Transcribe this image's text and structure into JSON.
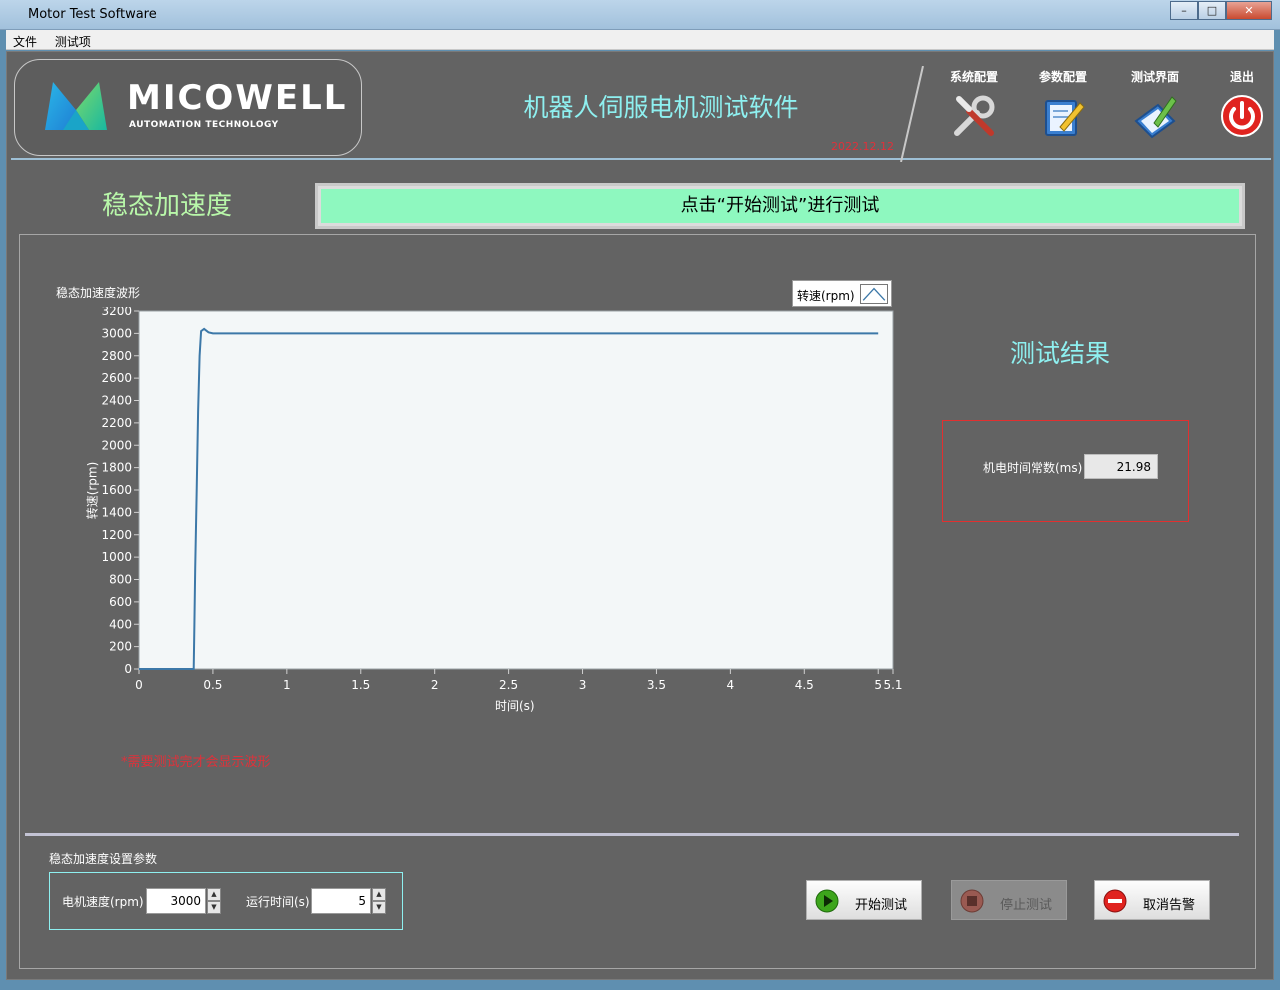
{
  "window": {
    "title": "Motor Test Software",
    "controls": {
      "minimize": "–",
      "maximize": "□",
      "close": "✕"
    }
  },
  "menu": {
    "items": [
      "文件",
      "测试项"
    ]
  },
  "header": {
    "logo_text": "MICOWELL",
    "logo_sub": "AUTOMATION TECHNOLOGY",
    "app_title": "机器人伺服电机测试软件",
    "date": "2022.12.12",
    "nav": [
      {
        "label": "系统配置",
        "icon": "tools-icon"
      },
      {
        "label": "参数配置",
        "icon": "edit-document-icon"
      },
      {
        "label": "测试界面",
        "icon": "clipboard-pen-icon"
      },
      {
        "label": "退出",
        "icon": "power-icon"
      }
    ]
  },
  "test": {
    "section_label": "稳态加速度",
    "prompt": "点击“开始测试”进行测试",
    "note": "*需要测试完才会显示波形"
  },
  "results": {
    "title": "测试结果",
    "label": "机电时间常数(ms)",
    "value": "21.98"
  },
  "params": {
    "title": "稳态加速度设置参数",
    "speed_label": "电机速度(rpm)",
    "speed_value": "3000",
    "time_label": "运行时间(s)",
    "time_value": "5"
  },
  "buttons": {
    "start": "开始测试",
    "stop": "停止测试",
    "cancel_alarm": "取消告警"
  },
  "colors": {
    "accent_cyan": "#8ef0f0",
    "accent_green": "#b8f7a9",
    "prompt_bg": "#8ef8bf",
    "alert_red": "#e0313a",
    "series": "#3c78a8"
  },
  "chart_data": {
    "type": "line",
    "title": "稳态加速度波形",
    "xlabel": "时间(s)",
    "ylabel": "转速(rpm)",
    "xlim": [
      0,
      5.1
    ],
    "ylim": [
      0,
      3200
    ],
    "x_ticks": [
      0,
      0.5,
      1,
      1.5,
      2,
      2.5,
      3,
      3.5,
      4,
      4.5,
      5,
      5.1
    ],
    "x_tick_labels": [
      "0",
      "0.5",
      "1",
      "1.5",
      "2",
      "2.5",
      "3",
      "3.5",
      "4",
      "4.5",
      "5",
      "5.1"
    ],
    "y_ticks": [
      0,
      200,
      400,
      600,
      800,
      1000,
      1200,
      1400,
      1600,
      1800,
      2000,
      2200,
      2400,
      2600,
      2800,
      3000,
      3200
    ],
    "grid": false,
    "legend_position": "top-right",
    "series": [
      {
        "name": "转速(rpm)",
        "x": [
          0,
          0.37,
          0.375,
          0.38,
          0.39,
          0.4,
          0.41,
          0.42,
          0.44,
          0.47,
          0.5,
          1,
          1.5,
          2,
          2.5,
          3,
          3.5,
          4,
          4.5,
          5
        ],
        "y": [
          0,
          0,
          400,
          900,
          1600,
          2300,
          2800,
          3020,
          3040,
          3010,
          3000,
          3000,
          3000,
          3000,
          3000,
          3000,
          3000,
          3000,
          3000,
          3000
        ]
      }
    ]
  }
}
